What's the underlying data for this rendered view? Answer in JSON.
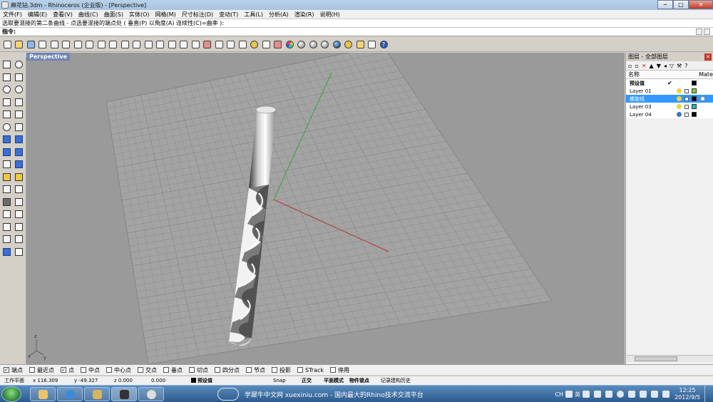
{
  "window": {
    "title": "麻花钻.3dm - Rhinoceros (企业版) - [Perspective]",
    "minimize": "─",
    "maximize": "□",
    "close": "✕"
  },
  "menu": [
    "文件(F)",
    "编辑(E)",
    "查看(V)",
    "曲线(C)",
    "曲面(S)",
    "实体(O)",
    "网格(M)",
    "尺寸标注(D)",
    "变动(T)",
    "工具(L)",
    "分析(A)",
    "渲染(R)",
    "说明(H)"
  ],
  "command": {
    "history": "选取要混接的第二条曲线 - 点选要混接的端点处 ( 垂直(P)  以角度(A)  连续性(C)=曲率 ):",
    "prompt": "指令:"
  },
  "viewport": {
    "tab": "Perspective",
    "axis_labels": {
      "x": "x",
      "y": "y",
      "z": "z"
    }
  },
  "layers": {
    "title": "图层 - 全部图层",
    "columns": {
      "name": "名称",
      "material": "Mate"
    },
    "rows": [
      {
        "name": "预设值",
        "current": "✔",
        "color": "#000000",
        "light": "none",
        "selected": false,
        "bold": true
      },
      {
        "name": "Layer 01",
        "current": "",
        "color": "#7fd13b",
        "light": "yellow",
        "selected": false,
        "bold": false
      },
      {
        "name": "螺旋线",
        "current": "",
        "color": "#000000",
        "light": "yellow",
        "selected": true,
        "bold": false
      },
      {
        "name": "Layer 03",
        "current": "",
        "color": "#1fb7b7",
        "light": "yellow",
        "selected": false,
        "bold": false
      },
      {
        "name": "Layer 04",
        "current": "",
        "color": "#000000",
        "light": "blue",
        "selected": false,
        "bold": false
      }
    ]
  },
  "osnap": [
    {
      "label": "端点",
      "checked": true
    },
    {
      "label": "最近点",
      "checked": false
    },
    {
      "label": "点",
      "checked": true
    },
    {
      "label": "中点",
      "checked": false
    },
    {
      "label": "中心点",
      "checked": false
    },
    {
      "label": "交点",
      "checked": false
    },
    {
      "label": "垂点",
      "checked": false
    },
    {
      "label": "切点",
      "checked": false
    },
    {
      "label": "四分点",
      "checked": false
    },
    {
      "label": "节点",
      "checked": false
    },
    {
      "label": "投影",
      "checked": false
    },
    {
      "label": "STrack",
      "checked": false
    },
    {
      "label": "停用",
      "checked": false
    }
  ],
  "status": {
    "cplane": "工作平面",
    "x": "x 116.309",
    "y": "y -49.327",
    "z": "z 0.000",
    "extra": "0.000",
    "layer": "预设值",
    "snap": "Snap",
    "ortho": "正交",
    "planar": "平面模式",
    "osnap": "物件锁点",
    "history": "记录建构历史"
  },
  "taskbar": {
    "banner": "学犀牛中文网 xuexiniu.com - 国内最大的Rhino技术交流平台",
    "lang": "CH",
    "ime": "英",
    "time": "12:25",
    "date": "2012/9/5"
  },
  "colors": {
    "viewport_bg": "#9a9a9a",
    "grid": "#8c8c8c",
    "x_axis": "#b23a3a",
    "y_axis": "#3aa33a",
    "selection": "#3399ff",
    "drill_light": "#f2f2f2",
    "drill_dark": "#4a4a4a"
  }
}
